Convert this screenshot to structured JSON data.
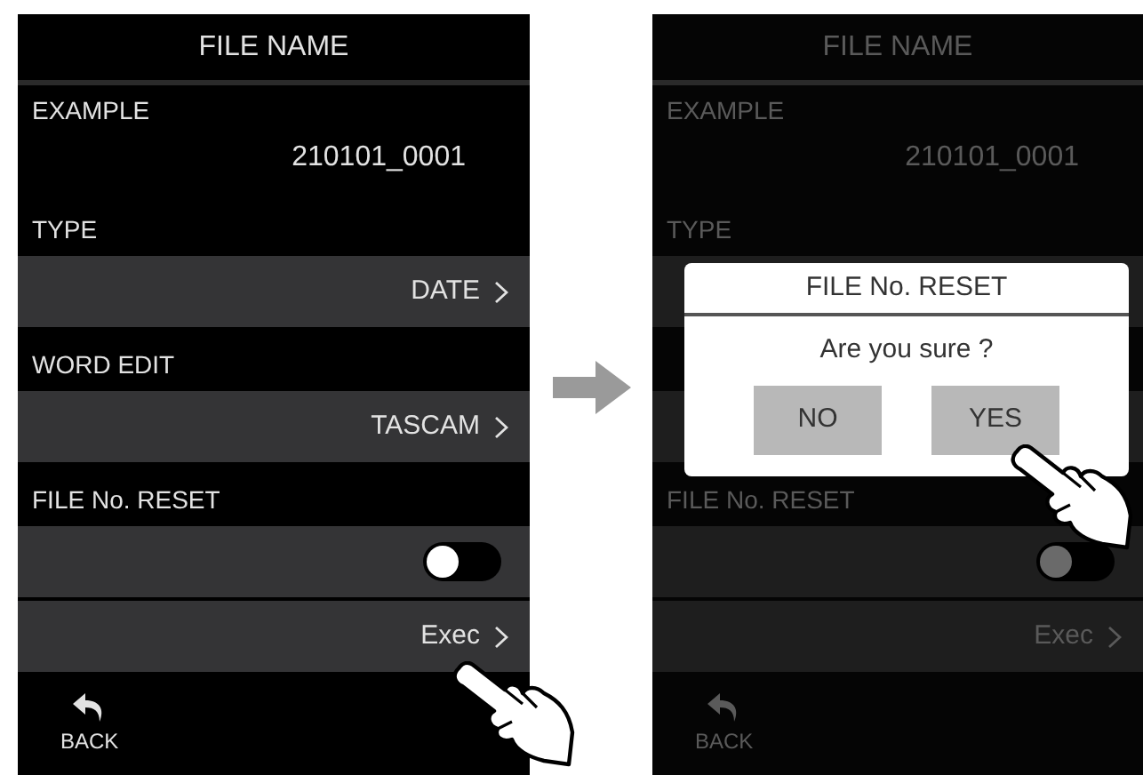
{
  "screens": [
    {
      "title": "FILE NAME",
      "dimmed": false,
      "rows": [
        {
          "kind": "info",
          "label": "EXAMPLE",
          "value": "210101_0001"
        },
        {
          "kind": "select",
          "label": "TYPE",
          "value": "DATE"
        },
        {
          "kind": "select",
          "label": "WORD EDIT",
          "value": "TASCAM"
        },
        {
          "kind": "toggle_exec",
          "label": "FILE No. RESET",
          "on": false,
          "action": "Exec"
        }
      ],
      "back": "BACK"
    },
    {
      "title": "FILE NAME",
      "dimmed": true,
      "rows": [
        {
          "kind": "info",
          "label": "EXAMPLE",
          "value": "210101_0001"
        },
        {
          "kind": "select",
          "label": "TYPE"
        },
        {
          "kind": "select"
        },
        {
          "kind": "toggle_exec",
          "label": "FILE No. RESET",
          "on": false,
          "action": "Exec"
        }
      ],
      "back": "BACK",
      "dialog": {
        "title": "FILE No. RESET",
        "message": "Are you sure ?",
        "buttons": [
          {
            "label": "NO"
          },
          {
            "label": "YES"
          }
        ]
      }
    }
  ]
}
